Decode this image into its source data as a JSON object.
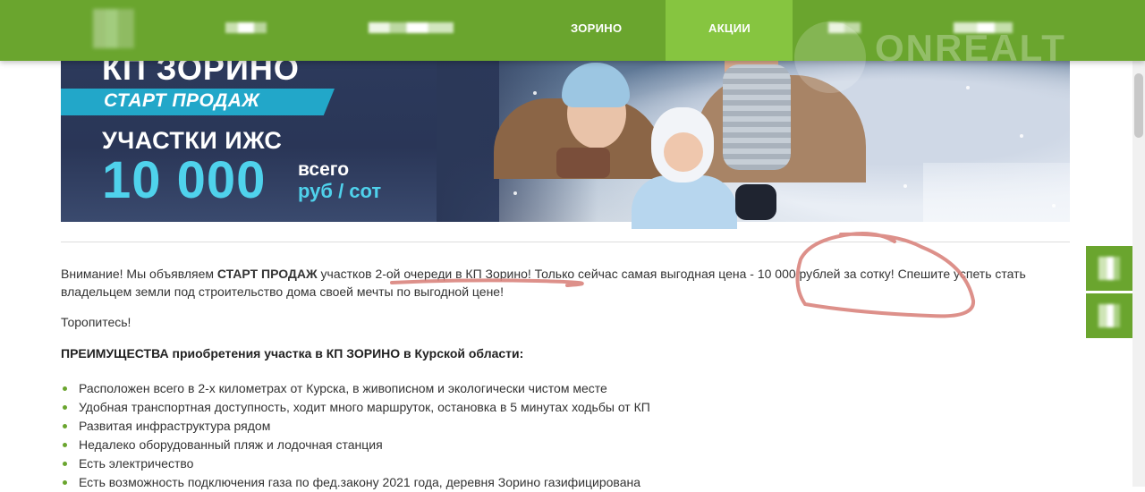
{
  "nav": {
    "items": [
      {
        "label": "ЗОРИНО"
      },
      {
        "label": "АКЦИИ",
        "active": true
      }
    ],
    "watermark": "ONREALT",
    "colors": {
      "nav_bg": "#6aa52e",
      "active_bg": "#86c540"
    }
  },
  "banner": {
    "title": "КП ЗОРИНО",
    "ribbon": "СТАРТ ПРОДАЖ",
    "subtitle": "УЧАСТКИ ИЖС",
    "price": "10 000",
    "price_prefix": "всего",
    "price_unit": "руб / сот"
  },
  "content": {
    "announce_pre": "Внимание! Мы объявляем ",
    "announce_bold": "СТАРТ ПРОДАЖ",
    "announce_post": " участков 2-ой очереди в КП Зорино! Только сейчас самая выгодная цена - 10 000 рублей за сотку! Спешите успеть стать владельцем земли под строительство дома своей мечты по выгодной цене!",
    "hurry": "Торопитесь!",
    "advantages_heading": "ПРЕИМУЩЕСТВА приобретения участка в КП ЗОРИНО в Курской области:",
    "advantages": [
      "Расположен всего в 2-х километрах от Курска, в живописном и экологически чистом месте",
      "Удобная транспортная доступность, ходит много маршруток, остановка в 5 минутах ходьбы от КП",
      "Развитая инфраструктура рядом",
      "Недалеко оборудованный пляж и лодочная станция",
      "Есть электричество",
      "Есть возможность подключения газа по фед.закону 2021 года, деревня Зорино газифицирована"
    ]
  },
  "annotations": {
    "color": "#d9847d"
  }
}
